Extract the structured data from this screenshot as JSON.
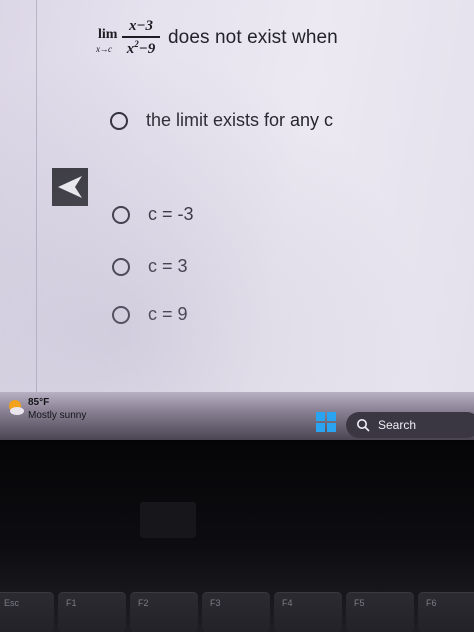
{
  "question": {
    "lim_word": "lim",
    "lim_subscript": "x→c",
    "numerator": "x−3",
    "denominator_base": "x",
    "denominator_exp": "2",
    "denominator_rest": "−9",
    "text": "does not exist when"
  },
  "options": [
    {
      "label": "the limit exists for any c"
    },
    {
      "label": "c = -3"
    },
    {
      "label": "c = 3"
    },
    {
      "label": "c = 9"
    }
  ],
  "taskbar": {
    "temperature": "85°F",
    "weather": "Mostly sunny",
    "search_label": "Search",
    "windows_color": "#2aa3f0"
  },
  "keyboard": {
    "keys": [
      "Esc",
      "F1",
      "F2",
      "F3",
      "F4",
      "F5",
      "F6"
    ]
  },
  "icons": {
    "back": "back-arrow-icon",
    "weather": "sun-cloud-icon",
    "windows": "windows-logo-icon",
    "search": "search-icon"
  }
}
